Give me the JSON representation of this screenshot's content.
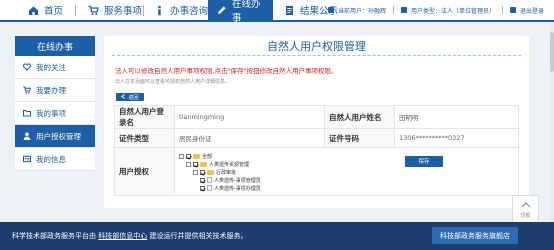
{
  "nav": {
    "items": [
      {
        "label": "首页",
        "icon": "home-icon"
      },
      {
        "label": "服务事项",
        "icon": "cart-icon"
      },
      {
        "label": "办事咨询",
        "icon": "info-icon"
      },
      {
        "label": "在线办事",
        "icon": "pencil-icon",
        "active": true
      },
      {
        "label": "结果公示",
        "icon": "document-icon"
      }
    ],
    "user": {
      "current_user": "当前用户：孙融辉",
      "user_type": "用户类型：法人（单位管理员）",
      "logout": "退出登录"
    }
  },
  "sidebar": {
    "title": "在线办事",
    "items": [
      {
        "label": "我的关注",
        "icon": "heart-icon"
      },
      {
        "label": "我要办理",
        "icon": "cart-icon"
      },
      {
        "label": "我的事项",
        "icon": "folder-icon"
      },
      {
        "label": "用户授权管理",
        "icon": "user-icon",
        "active": true
      },
      {
        "label": "我的信息",
        "icon": "id-card-icon"
      }
    ]
  },
  "main": {
    "title": "自然人用户权限管理",
    "notice": "法人可以修改自然人用户事项权限,点击\"保存\"按钮修改自然人用户事项权限。",
    "subnotice": "法人在本页面可以查看可授权自然人用户详细信息。",
    "back_label": "返回",
    "form": {
      "login_name_label": "自然人用户登录名",
      "login_name_value": "tianmingming",
      "name_label": "自然人用户姓名",
      "name_value": "田明明",
      "cert_type_label": "证件类型",
      "cert_type_value": "居民身份证",
      "cert_no_label": "证件号码",
      "cert_no_value": "1306**********0327",
      "auth_label": "用户授权",
      "save_label": "保存"
    },
    "tree": [
      {
        "label": "全部"
      },
      {
        "label": "人类遗传资源管理"
      },
      {
        "label": "行政审批"
      },
      {
        "label": "人类遗传-事项管理员"
      },
      {
        "label": "人类遗传-事项办理员"
      }
    ]
  },
  "float": {
    "back_top": "顶部"
  },
  "footer": {
    "text_before": "科学技术部政务服务平台由",
    "link": "科技部信息中心",
    "text_after": "建设运行并提供相关技术服务。",
    "button": "科技部政务服务旗舰店"
  },
  "colors": {
    "primary": "#1c5fa6",
    "footer": "#1c3f70",
    "notice": "#e02020"
  }
}
